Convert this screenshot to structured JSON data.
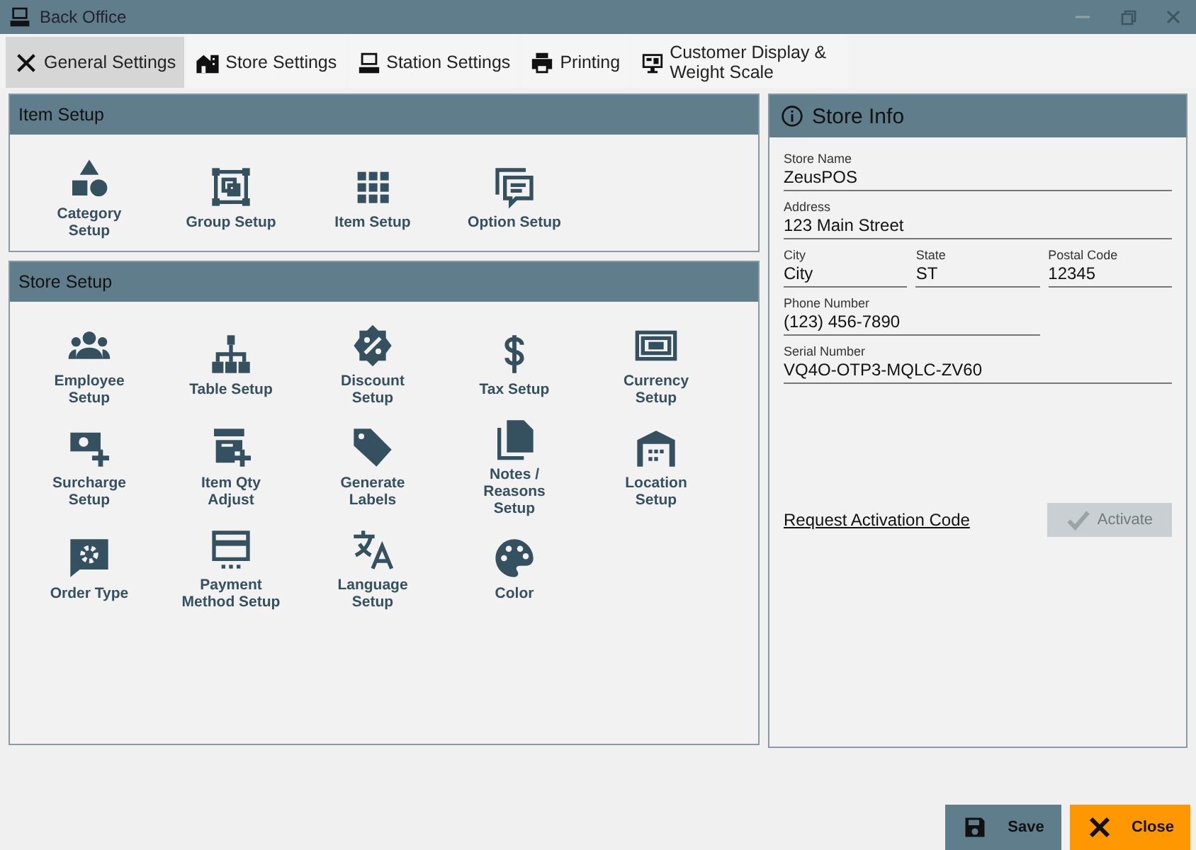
{
  "window": {
    "title": "Back Office"
  },
  "tabs": [
    {
      "label": "General Settings",
      "selected": true
    },
    {
      "label": "Store Settings",
      "selected": false
    },
    {
      "label": "Station Settings",
      "selected": false
    },
    {
      "label": "Printing",
      "selected": false
    },
    {
      "label": "Customer Display & Weight Scale",
      "selected": false
    }
  ],
  "sections": [
    {
      "title": "Item Setup",
      "tiles": [
        "Category Setup",
        "Group Setup",
        "Item Setup",
        "Option Setup"
      ]
    },
    {
      "title": "Store Setup",
      "tiles": [
        "Employee Setup",
        "Table Setup",
        "Discount Setup",
        "Tax Setup",
        "Currency Setup",
        "Surcharge Setup",
        "Item Qty Adjust",
        "Generate Labels",
        "Notes / Reasons Setup",
        "Location Setup",
        "Order Type",
        "Payment Method Setup",
        "Language Setup",
        "Color"
      ]
    }
  ],
  "store_info": {
    "title": "Store Info",
    "fields": [
      {
        "label": "Store Name",
        "value": "ZeusPOS"
      },
      {
        "label": "Address",
        "value": "123 Main Street"
      },
      {
        "label": "City",
        "value": "City"
      },
      {
        "label": "State",
        "value": "ST"
      },
      {
        "label": "Postal Code",
        "value": "12345"
      },
      {
        "label": "Phone Number",
        "value": "(123) 456-7890"
      },
      {
        "label": "Serial Number",
        "value": "VQ4O-OTP3-MQLC-ZV60"
      }
    ],
    "link": "Request Activation Code",
    "activate": {
      "label": "Activate",
      "disabled": true
    }
  },
  "buttons": [
    {
      "label": "Save",
      "kind": "save"
    },
    {
      "label": "Close",
      "kind": "close"
    }
  ]
}
